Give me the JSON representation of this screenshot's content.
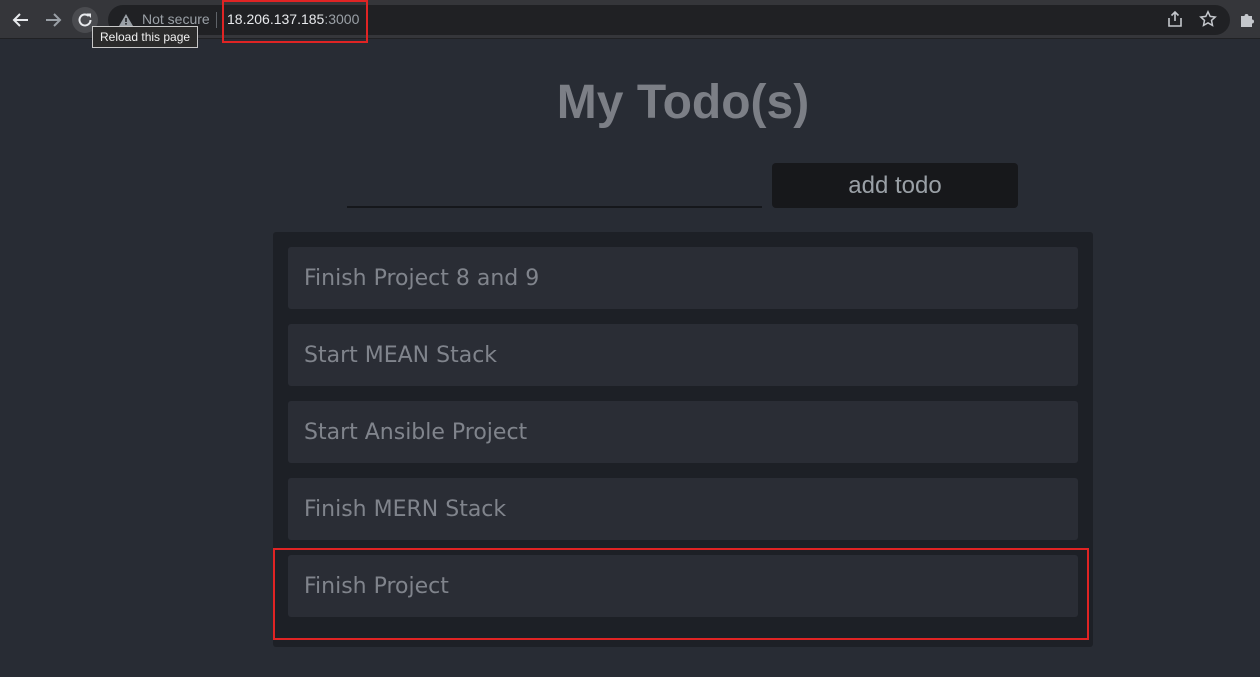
{
  "browser": {
    "security_label": "Not secure",
    "url_host": "18.206.137.185",
    "url_port": ":3000",
    "tooltip": "Reload this page",
    "icons": [
      "back-icon",
      "forward-icon",
      "reload-icon",
      "warning-icon",
      "share-icon",
      "star-icon",
      "extensions-icon"
    ]
  },
  "app": {
    "title": "My Todo(s)",
    "input": {
      "value": "",
      "placeholder": ""
    },
    "add_button_label": "add todo",
    "todos": [
      "Finish Project 8 and 9",
      "Start MEAN Stack",
      "Start Ansible Project",
      "Finish MERN Stack",
      "Finish Project"
    ]
  },
  "annotations": {
    "highlight_color": "#e02424"
  }
}
